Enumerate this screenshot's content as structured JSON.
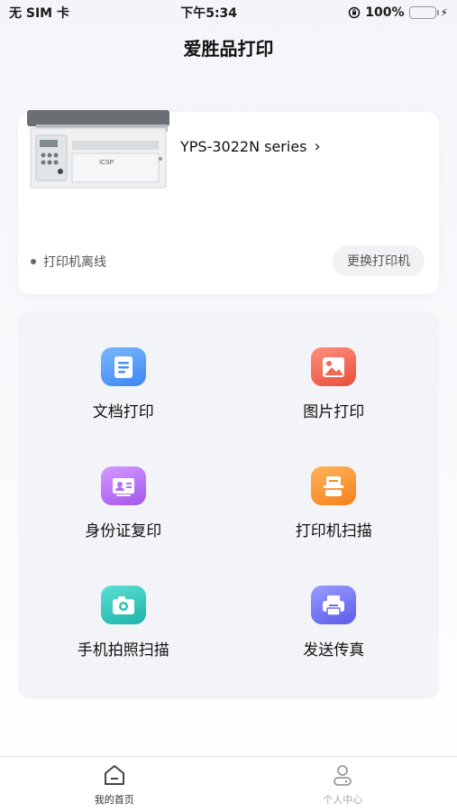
{
  "status_bar": {
    "carrier": "无 SIM 卡",
    "time": "下午5:34",
    "battery": "100%"
  },
  "nav": {
    "title": "爱胜品打印"
  },
  "printer": {
    "name": "YPS-3022N series",
    "status": "打印机离线",
    "change_label": "更换打印机",
    "brand": "ICSP"
  },
  "features": [
    {
      "label": "文档打印",
      "icon": "document-icon",
      "color": "#4a90f5"
    },
    {
      "label": "图片打印",
      "icon": "image-icon",
      "color": "#f06a55"
    },
    {
      "label": "身份证复印",
      "icon": "id-card-icon",
      "color": "#b86ef0"
    },
    {
      "label": "打印机扫描",
      "icon": "scanner-icon",
      "color": "#f7921e"
    },
    {
      "label": "手机拍照扫描",
      "icon": "camera-icon",
      "color": "#27c2b8"
    },
    {
      "label": "发送传真",
      "icon": "fax-icon",
      "color": "#6e6ef0"
    }
  ],
  "tabs": [
    {
      "label": "我的首页",
      "icon": "home-icon",
      "active": true
    },
    {
      "label": "个人中心",
      "icon": "user-icon",
      "active": false
    }
  ]
}
